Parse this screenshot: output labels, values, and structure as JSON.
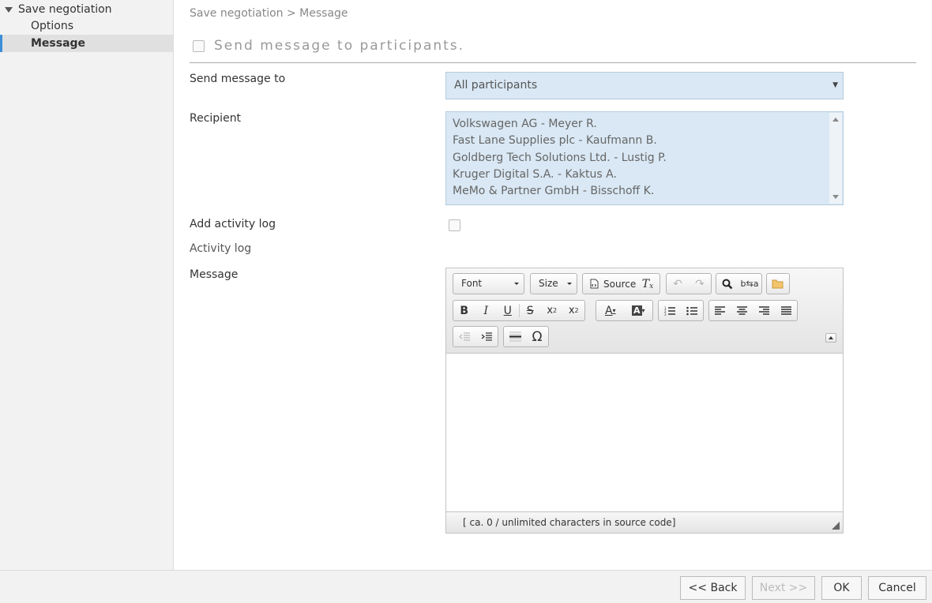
{
  "sidebar": {
    "root_label": "Save negotiation",
    "items": [
      {
        "label": "Options"
      },
      {
        "label": "Message"
      }
    ]
  },
  "breadcrumb": "Save negotiation > Message",
  "section_title": "Send message to participants.",
  "form": {
    "send_to_label": "Send message to",
    "send_to_value": "All participants",
    "recipient_label": "Recipient",
    "recipients": [
      "Volkswagen AG - Meyer R.",
      "Fast Lane Supplies plc - Kaufmann B.",
      "Goldberg Tech Solutions Ltd. - Lustig P.",
      "Kruger Digital S.A. - Kaktus A.",
      "MeMo & Partner GmbH - Bisschoff K."
    ],
    "add_activity_label": "Add activity log",
    "activity_log_label": "Activity log",
    "message_label": "Message"
  },
  "editor": {
    "font_label": "Font",
    "size_label": "Size",
    "source_label": "Source",
    "status_text": "[ ca. 0 / unlimited characters in source code]"
  },
  "footer": {
    "back_label": "<< Back",
    "next_label": "Next >>",
    "ok_label": "OK",
    "cancel_label": "Cancel"
  },
  "colors": {
    "accent": "#3b8fd9",
    "field_bg": "#d9e8f4"
  }
}
